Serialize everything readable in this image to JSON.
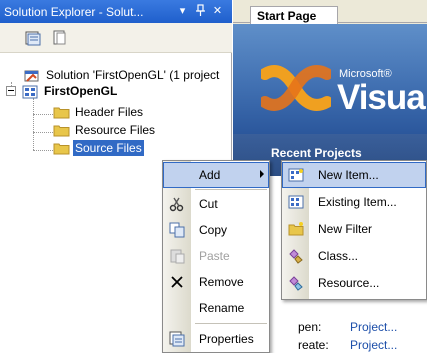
{
  "solution_explorer": {
    "title": "Solution Explorer - Solut...",
    "title_buttons": {
      "dropdown": "▾",
      "pin": "ᵰ",
      "close": "✕"
    },
    "toolbar": [
      {
        "name": "properties-icon"
      },
      {
        "name": "show-all-files-icon"
      }
    ],
    "tree": {
      "solution": "Solution 'FirstOpenGL' (1 project",
      "project": "FirstOpenGL",
      "folders": [
        "Header Files",
        "Resource Files",
        "Source Files"
      ]
    }
  },
  "document_tabs": {
    "active_tab": "Start Page"
  },
  "start_page": {
    "banner_microsoft": "Microsoft®",
    "banner_product": "Visua",
    "recent_projects": "Recent Projects",
    "open_label": "pen:",
    "open_link": "Project...",
    "create_label": "reate:",
    "create_link": "Project..."
  },
  "context_menu": {
    "items": [
      {
        "label": "Add",
        "icon": "none",
        "has_submenu": true,
        "highlighted": true
      },
      {
        "label": "Cut",
        "icon": "scissors-icon"
      },
      {
        "label": "Copy",
        "icon": "copy-icon"
      },
      {
        "label": "Paste",
        "icon": "paste-icon",
        "disabled": true
      },
      {
        "label": "Remove",
        "icon": "remove-x-icon"
      },
      {
        "label": "Rename",
        "icon": "none"
      },
      {
        "label": "Properties",
        "icon": "properties-icon"
      }
    ]
  },
  "add_submenu": {
    "items": [
      {
        "label": "New Item...",
        "icon": "new-item-icon",
        "highlighted": true
      },
      {
        "label": "Existing Item...",
        "icon": "existing-item-icon"
      },
      {
        "label": "New Filter",
        "icon": "new-filter-icon"
      },
      {
        "label": "Class...",
        "icon": "class-icon"
      },
      {
        "label": "Resource...",
        "icon": "resource-icon"
      }
    ]
  },
  "colors": {
    "titlebar": "#1f5fcc",
    "selection": "#316ac5",
    "menu_highlight": "#c1d2ee",
    "folder": "#e8c64a",
    "link": "#1c4ea9"
  }
}
